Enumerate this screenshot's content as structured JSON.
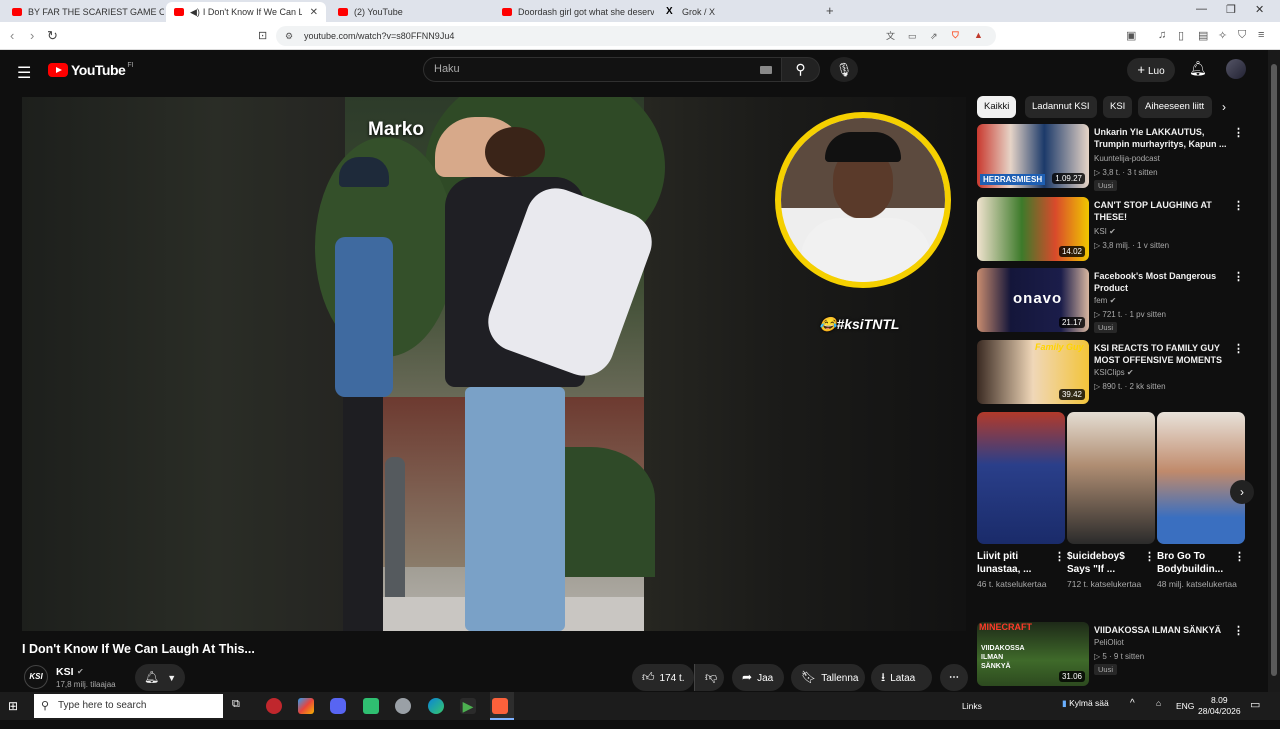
{
  "browser": {
    "tabs": [
      {
        "title": "BY FAR THE SCARIEST GAME OF THE"
      },
      {
        "title": "I Don't Know If We Can Laugh"
      },
      {
        "title": "(2) YouTube"
      },
      {
        "title": "Doordash girl got what she deserved"
      },
      {
        "title": "Grok / X"
      }
    ],
    "new_tab": "+",
    "url": "youtube.com/watch?v=s80FFNN9Ju4"
  },
  "youtube": {
    "logo_text": "YouTube",
    "country_code": "FI",
    "search_placeholder": "Haku",
    "create_label": "Luo"
  },
  "video": {
    "overlay_name": "Marko",
    "cam_tag": "#ksiTNTL",
    "title": "I Don't Know If We Can Laugh At This...",
    "channel": "KSI",
    "channel_avatar_text": "KSI",
    "subscribers": "17,8 milj. tilaajaa",
    "likes": "174 t.",
    "share_label": "Jaa",
    "save_label": "Tallenna",
    "download_label": "Lataa"
  },
  "sidebar": {
    "chips": [
      "Kaikki",
      "Ladannut KSI",
      "KSI",
      "Aiheeseen liitt"
    ],
    "recommendations": [
      {
        "title": "Unkarin Yle LAKKAUTUS, Trumpin murhayritys, Kapun ...",
        "channel": "Kuuntelija-podcast",
        "meta": "3,8 t. · 3 t sitten",
        "badge": "Uusi",
        "duration": "1.09.27",
        "thumb_text": "HERRASMIESH",
        "verified": false
      },
      {
        "title": "CAN'T STOP LAUGHING AT THESE!",
        "channel": "KSI",
        "meta": "3,8 milj. · 1 v sitten",
        "badge": "",
        "duration": "14.02",
        "thumb_text": "",
        "verified": true
      },
      {
        "title": "Facebook's Most Dangerous Product",
        "channel": "fem",
        "meta": "721 t. · 1 pv sitten",
        "badge": "Uusi",
        "duration": "21.17",
        "thumb_text": "onavo",
        "verified": true
      },
      {
        "title": "KSI REACTS TO FAMILY GUY MOST OFFENSIVE MOMENTS",
        "channel": "KSIClips",
        "meta": "890 t. · 2 kk sitten",
        "badge": "",
        "duration": "39.42",
        "thumb_text": "Family Guy",
        "verified": true
      }
    ],
    "shorts": [
      {
        "title": "Liivit piti lunastaa, ...",
        "views": "46 t. katselukertaa"
      },
      {
        "title": "$uicideboy$ Says \"If ...",
        "views": "712 t. katselukertaa"
      },
      {
        "title": "Bro Go To Bodybuildin...",
        "views": "48 milj. katselukertaa"
      }
    ],
    "last_rec": {
      "title": "VIIDAKOSSA ILMAN SÄNKYÄ",
      "channel": "PeliOliot",
      "meta": "5 · 9 t sitten",
      "badge": "Uusi",
      "duration": "31.06",
      "thumb_text": "MINECRAFT",
      "thumb_sub": "VIIDAKOSSA ILMAN SÄNKYÄ"
    }
  },
  "taskbar": {
    "search_placeholder": "Type here to search",
    "links_label": "Links",
    "weather": "Kylmä sää",
    "lang": "ENG",
    "time": "8.09",
    "date": "28/04/2026"
  },
  "colors": {
    "accent": "#ff0000",
    "cam_ring": "#f5d000"
  }
}
